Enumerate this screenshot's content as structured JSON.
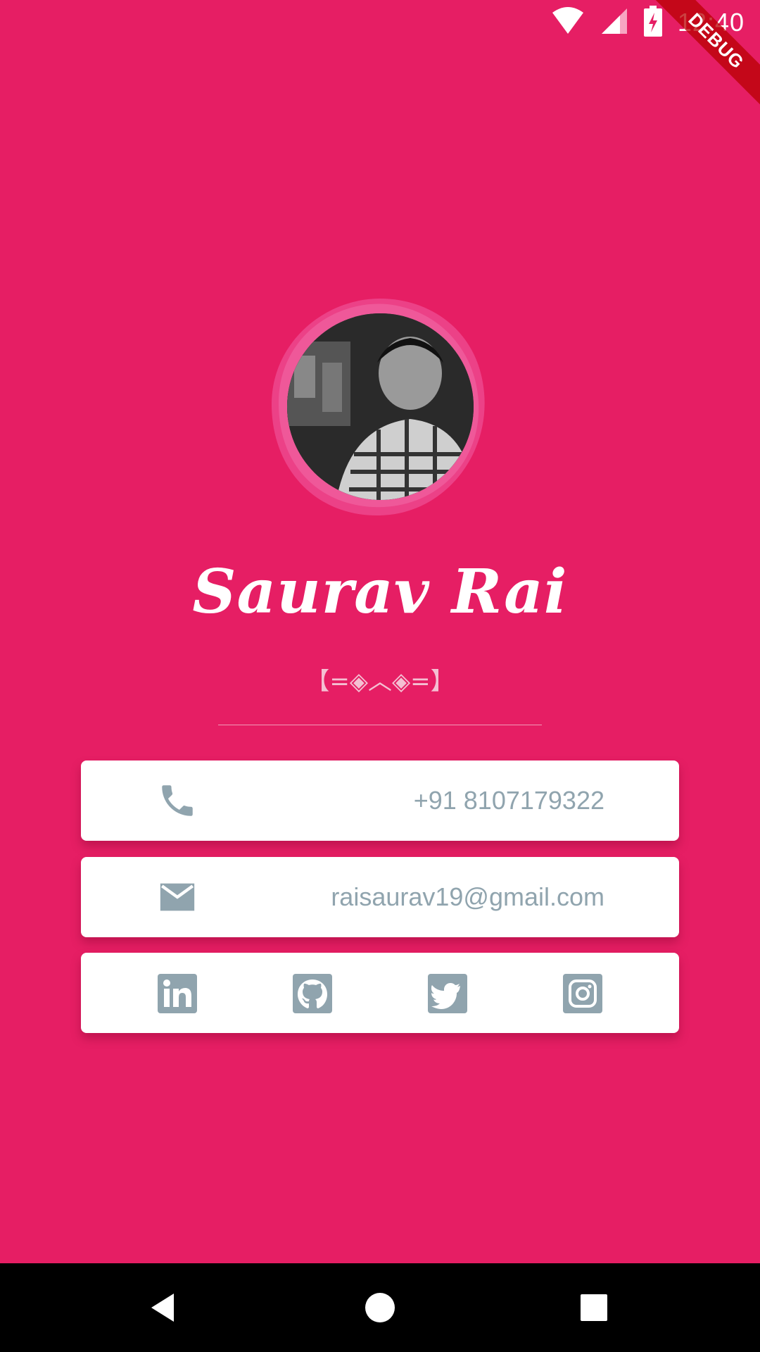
{
  "status_bar": {
    "time": "12:40",
    "icons": [
      "wifi-icon",
      "signal-icon",
      "battery-charging-icon"
    ]
  },
  "debug_banner": {
    "label": "DEBUG"
  },
  "profile": {
    "name": "Saurav Rai",
    "tagline": "【=◈︿◈=】"
  },
  "contact": {
    "phone": {
      "icon": "phone-icon",
      "value": "+91 8107179322"
    },
    "email": {
      "icon": "mail-icon",
      "value": "raisaurav19@gmail.com"
    }
  },
  "social": [
    {
      "icon": "linkedin-icon"
    },
    {
      "icon": "github-icon"
    },
    {
      "icon": "twitter-icon"
    },
    {
      "icon": "instagram-icon"
    }
  ],
  "navigation": {
    "buttons": [
      "back-icon",
      "home-icon",
      "recents-icon"
    ]
  },
  "colors": {
    "background": "#E61E64",
    "card": "#FFFFFF",
    "icon_and_text": "#90A4AE",
    "tagline": "#F4BFD2"
  }
}
